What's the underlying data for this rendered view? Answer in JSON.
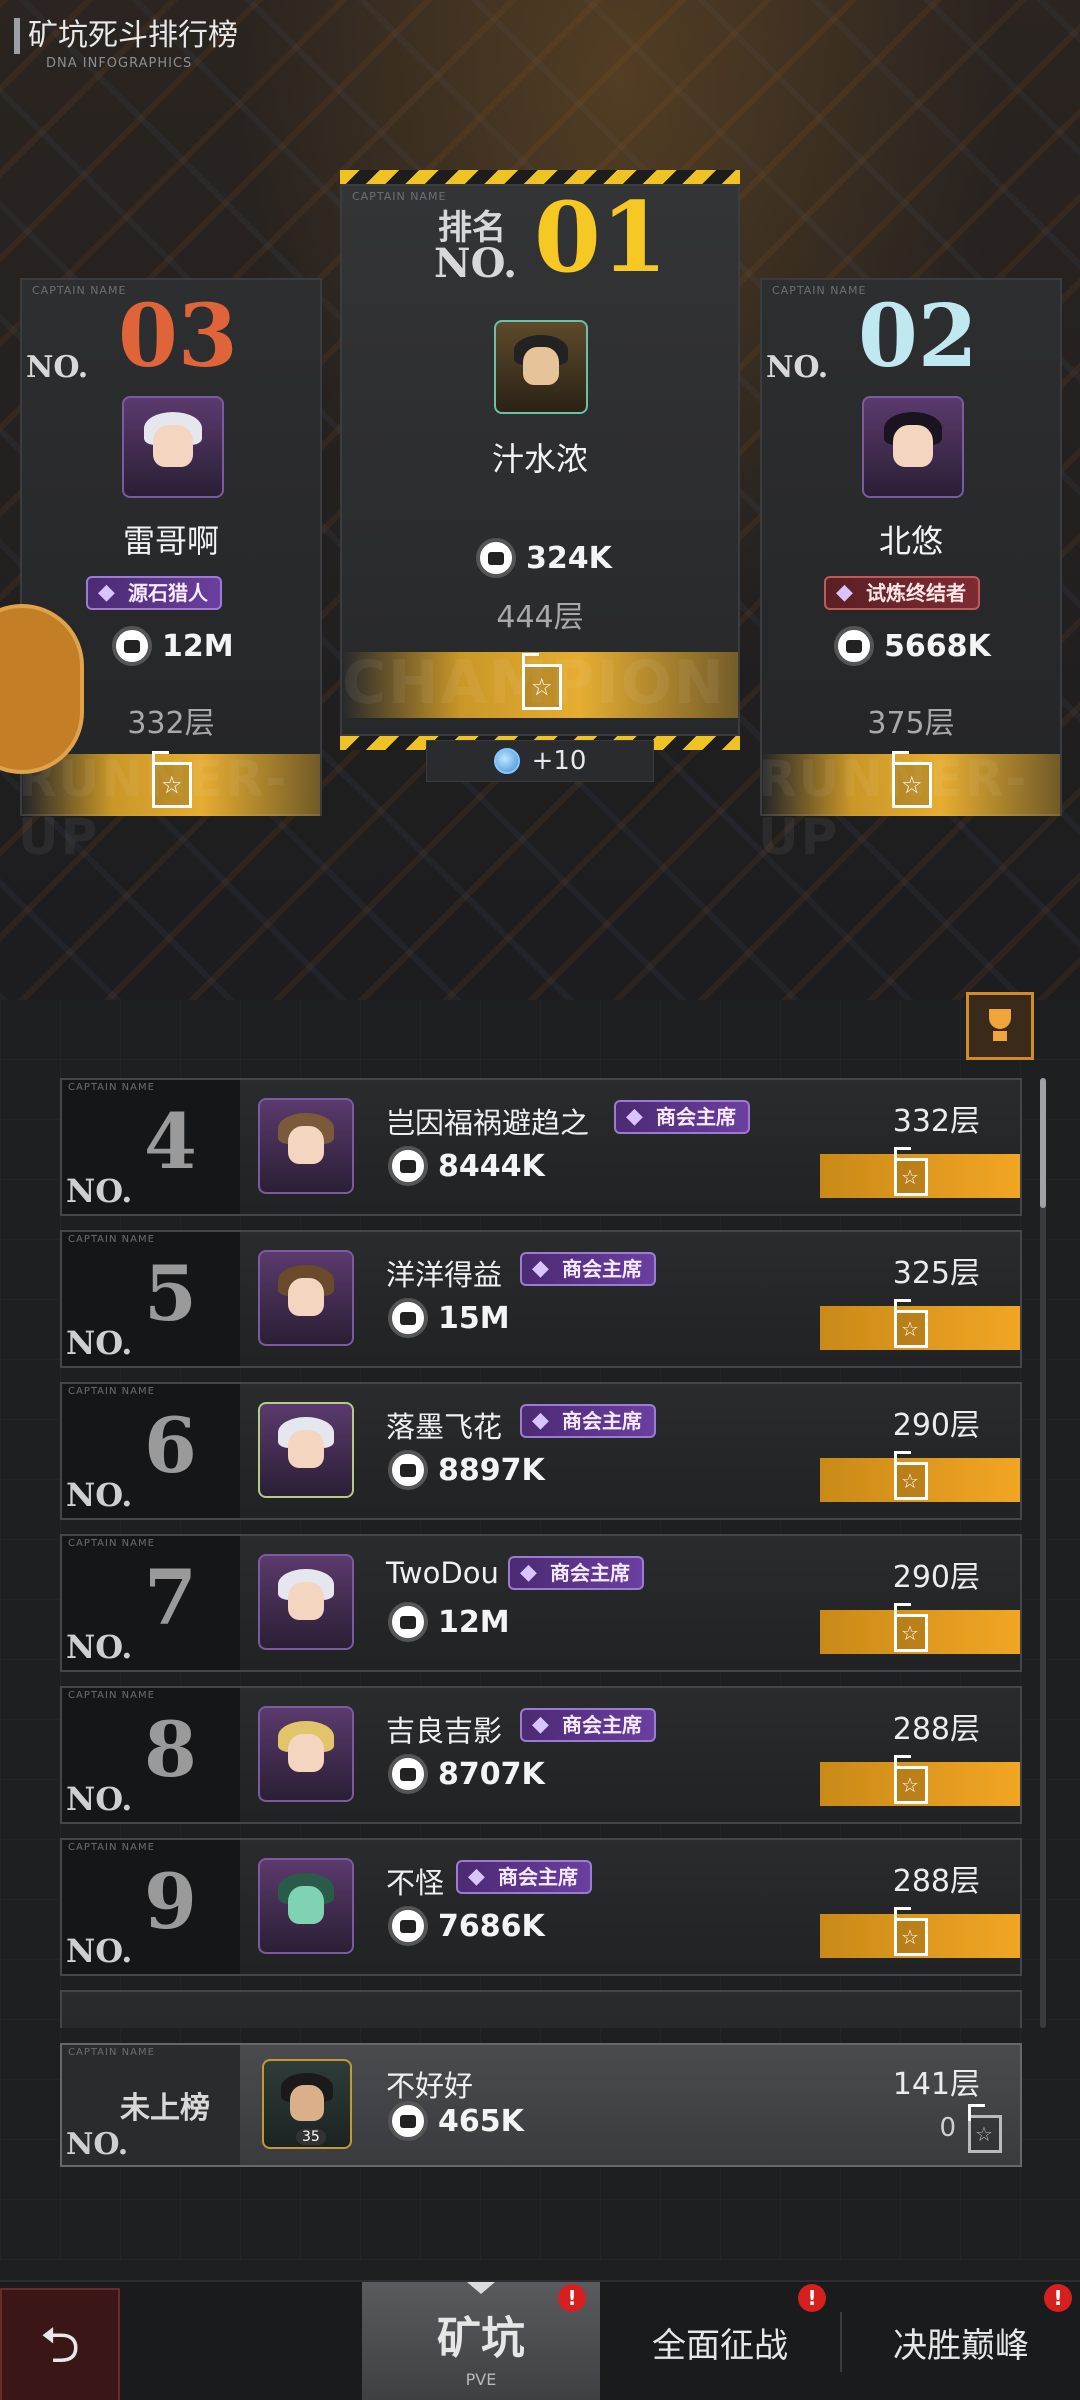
{
  "header": {
    "title": "矿坑死斗排行榜",
    "subtitle": "DNA INFOGRAPHICS"
  },
  "decor": {
    "captain_name": "CAPTAIN NAME",
    "runner_up": "RUNNER-UP",
    "champion": "CHAMPION"
  },
  "podium": {
    "first": {
      "label": "排名",
      "no": "NO.",
      "rank": "01",
      "name": "汁水浓",
      "power": "324K",
      "floor": "444层",
      "bonus": "+10"
    },
    "second": {
      "no": "NO.",
      "rank": "02",
      "name": "北悠",
      "badge": "试炼终结者",
      "power": "5668K",
      "floor": "375层"
    },
    "third": {
      "no": "NO.",
      "rank": "03",
      "name": "雷哥啊",
      "badge": "源石猎人",
      "power": "12M",
      "floor": "332层"
    }
  },
  "list": {
    "no_label": "NO.",
    "rows": [
      {
        "rank": "4",
        "name": "岂因福祸避趋之",
        "badge": "商会主席",
        "power": "8444K",
        "floor": "332层"
      },
      {
        "rank": "5",
        "name": "洋洋得益",
        "badge": "商会主席",
        "power": "15M",
        "floor": "325层"
      },
      {
        "rank": "6",
        "name": "落墨飞花",
        "badge": "商会主席",
        "power": "8897K",
        "floor": "290层"
      },
      {
        "rank": "7",
        "name": "TwoDou",
        "badge": "商会主席",
        "power": "12M",
        "floor": "290层"
      },
      {
        "rank": "8",
        "name": "吉良吉影",
        "badge": "商会主席",
        "power": "8707K",
        "floor": "288层"
      },
      {
        "rank": "9",
        "name": "不怪",
        "badge": "商会主席",
        "power": "7686K",
        "floor": "288层"
      }
    ]
  },
  "my_rank": {
    "status": "未上榜",
    "no": "NO.",
    "name": "不好好",
    "level": "35",
    "power": "465K",
    "floor": "141层",
    "flag_count": "0"
  },
  "tabs": [
    {
      "label": "矿坑",
      "sub": "PVE",
      "alert": "!"
    },
    {
      "label": "全面征战",
      "alert": "!"
    },
    {
      "label": "决胜巅峰",
      "alert": "!"
    }
  ],
  "back": {
    "icon": "back-arrow-icon",
    "glyph": "⮌"
  },
  "colors": {
    "gold": "#f2a524",
    "hazard": "#f0c324",
    "first_rank": "#f5c823",
    "second_rank": "#bfe8f0",
    "third_rank": "#e0643a"
  }
}
